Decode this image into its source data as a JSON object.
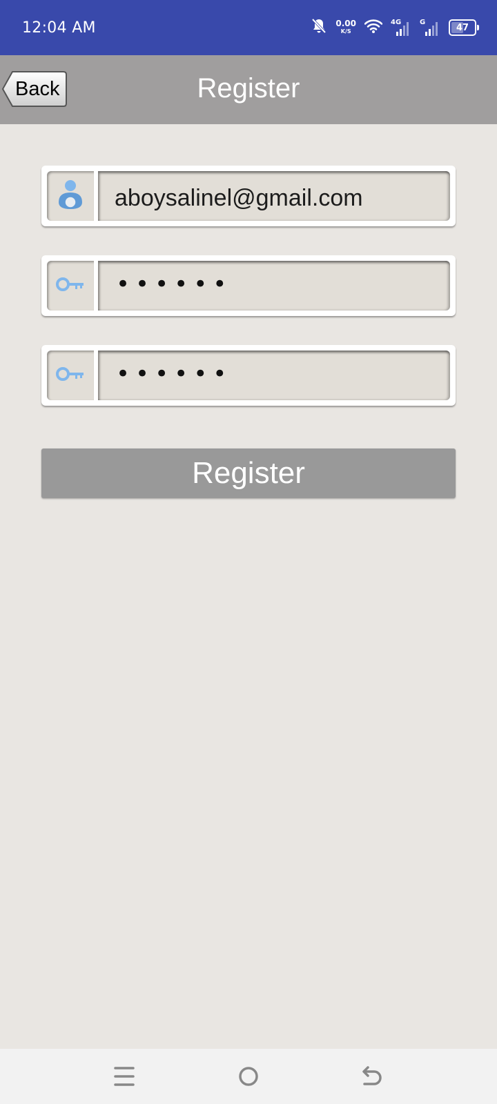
{
  "status_bar": {
    "time": "12:04 AM",
    "net_speed_value": "0.00",
    "net_speed_unit": "K/S",
    "signal1_label": "4G",
    "signal2_label": "G",
    "battery_level": "47"
  },
  "header": {
    "back_label": "Back",
    "title": "Register"
  },
  "form": {
    "email_value": "aboysalinel@gmail.com",
    "password_value": "••••••",
    "confirm_password_value": "••••••",
    "register_label": "Register"
  },
  "colors": {
    "status_bar": "#3949ab",
    "title_bar": "#a09e9e",
    "background": "#e9e6e2",
    "button": "#999999",
    "icon_blue": "#7fb6ec"
  },
  "icons": {
    "email": "user-icon",
    "password": "key-icon",
    "confirm_password": "key-icon"
  }
}
